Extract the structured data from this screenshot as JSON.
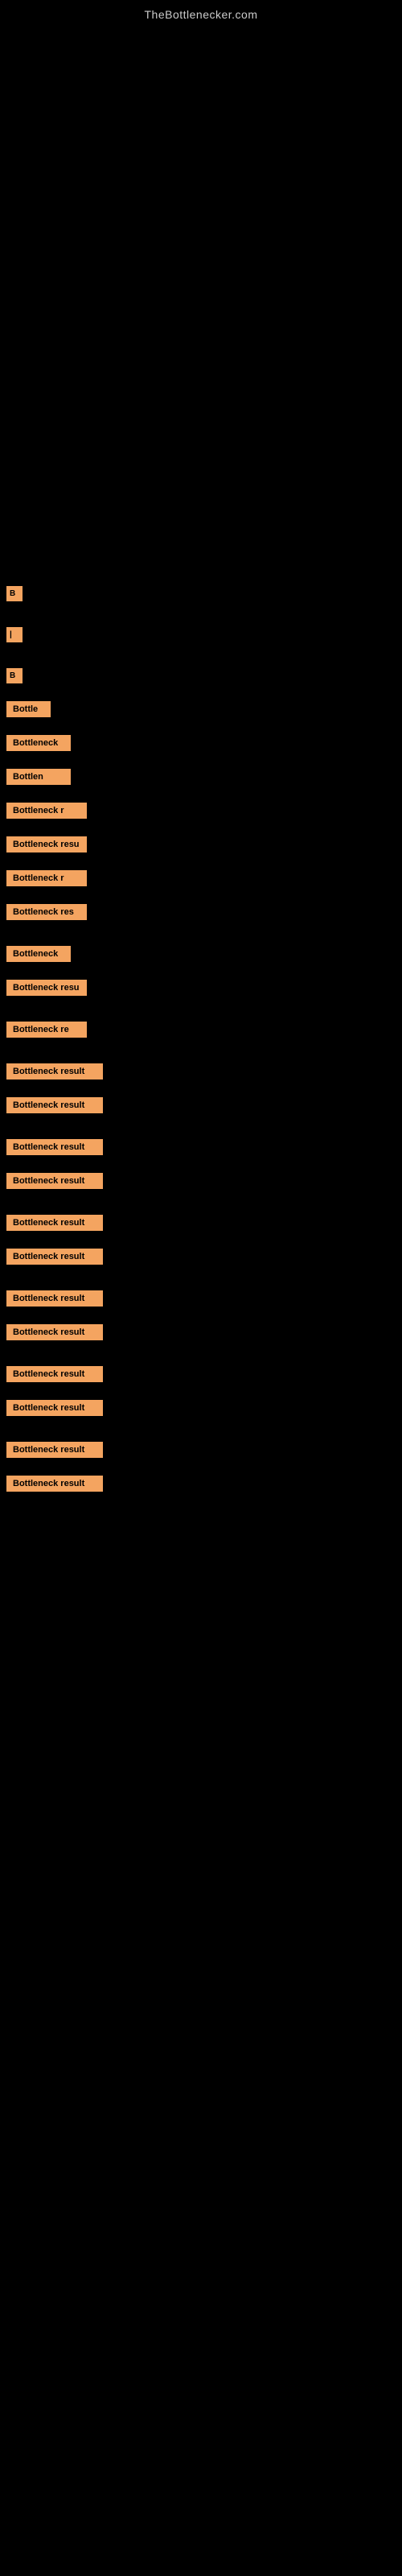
{
  "site": {
    "title": "TheBottlenecker.com"
  },
  "results": [
    {
      "id": "r1",
      "label": "B",
      "size": "xs"
    },
    {
      "id": "r2",
      "label": "|",
      "size": "xs"
    },
    {
      "id": "r3",
      "label": "B",
      "size": "xs"
    },
    {
      "id": "r4",
      "label": "Bottle",
      "size": "sm"
    },
    {
      "id": "r5",
      "label": "Bottleneck",
      "size": "md"
    },
    {
      "id": "r6",
      "label": "Bottlen",
      "size": "md"
    },
    {
      "id": "r7",
      "label": "Bottleneck r",
      "size": "lg"
    },
    {
      "id": "r8",
      "label": "Bottleneck resu",
      "size": "lg"
    },
    {
      "id": "r9",
      "label": "Bottleneck r",
      "size": "lg"
    },
    {
      "id": "r10",
      "label": "Bottleneck res",
      "size": "lg"
    },
    {
      "id": "r11",
      "label": "Bottleneck",
      "size": "md"
    },
    {
      "id": "r12",
      "label": "Bottleneck resu",
      "size": "lg"
    },
    {
      "id": "r13",
      "label": "Bottleneck re",
      "size": "lg"
    },
    {
      "id": "r14",
      "label": "Bottleneck result",
      "size": "xl"
    },
    {
      "id": "r15",
      "label": "Bottleneck result",
      "size": "xl"
    },
    {
      "id": "r16",
      "label": "Bottleneck result",
      "size": "xl"
    },
    {
      "id": "r17",
      "label": "Bottleneck result",
      "size": "xl"
    },
    {
      "id": "r18",
      "label": "Bottleneck result",
      "size": "xl"
    },
    {
      "id": "r19",
      "label": "Bottleneck result",
      "size": "xl"
    },
    {
      "id": "r20",
      "label": "Bottleneck result",
      "size": "xl"
    },
    {
      "id": "r21",
      "label": "Bottleneck result",
      "size": "xl"
    },
    {
      "id": "r22",
      "label": "Bottleneck result",
      "size": "xl"
    },
    {
      "id": "r23",
      "label": "Bottleneck result",
      "size": "xl"
    },
    {
      "id": "r24",
      "label": "Bottleneck result",
      "size": "xl"
    },
    {
      "id": "r25",
      "label": "Bottleneck result",
      "size": "xl"
    }
  ]
}
